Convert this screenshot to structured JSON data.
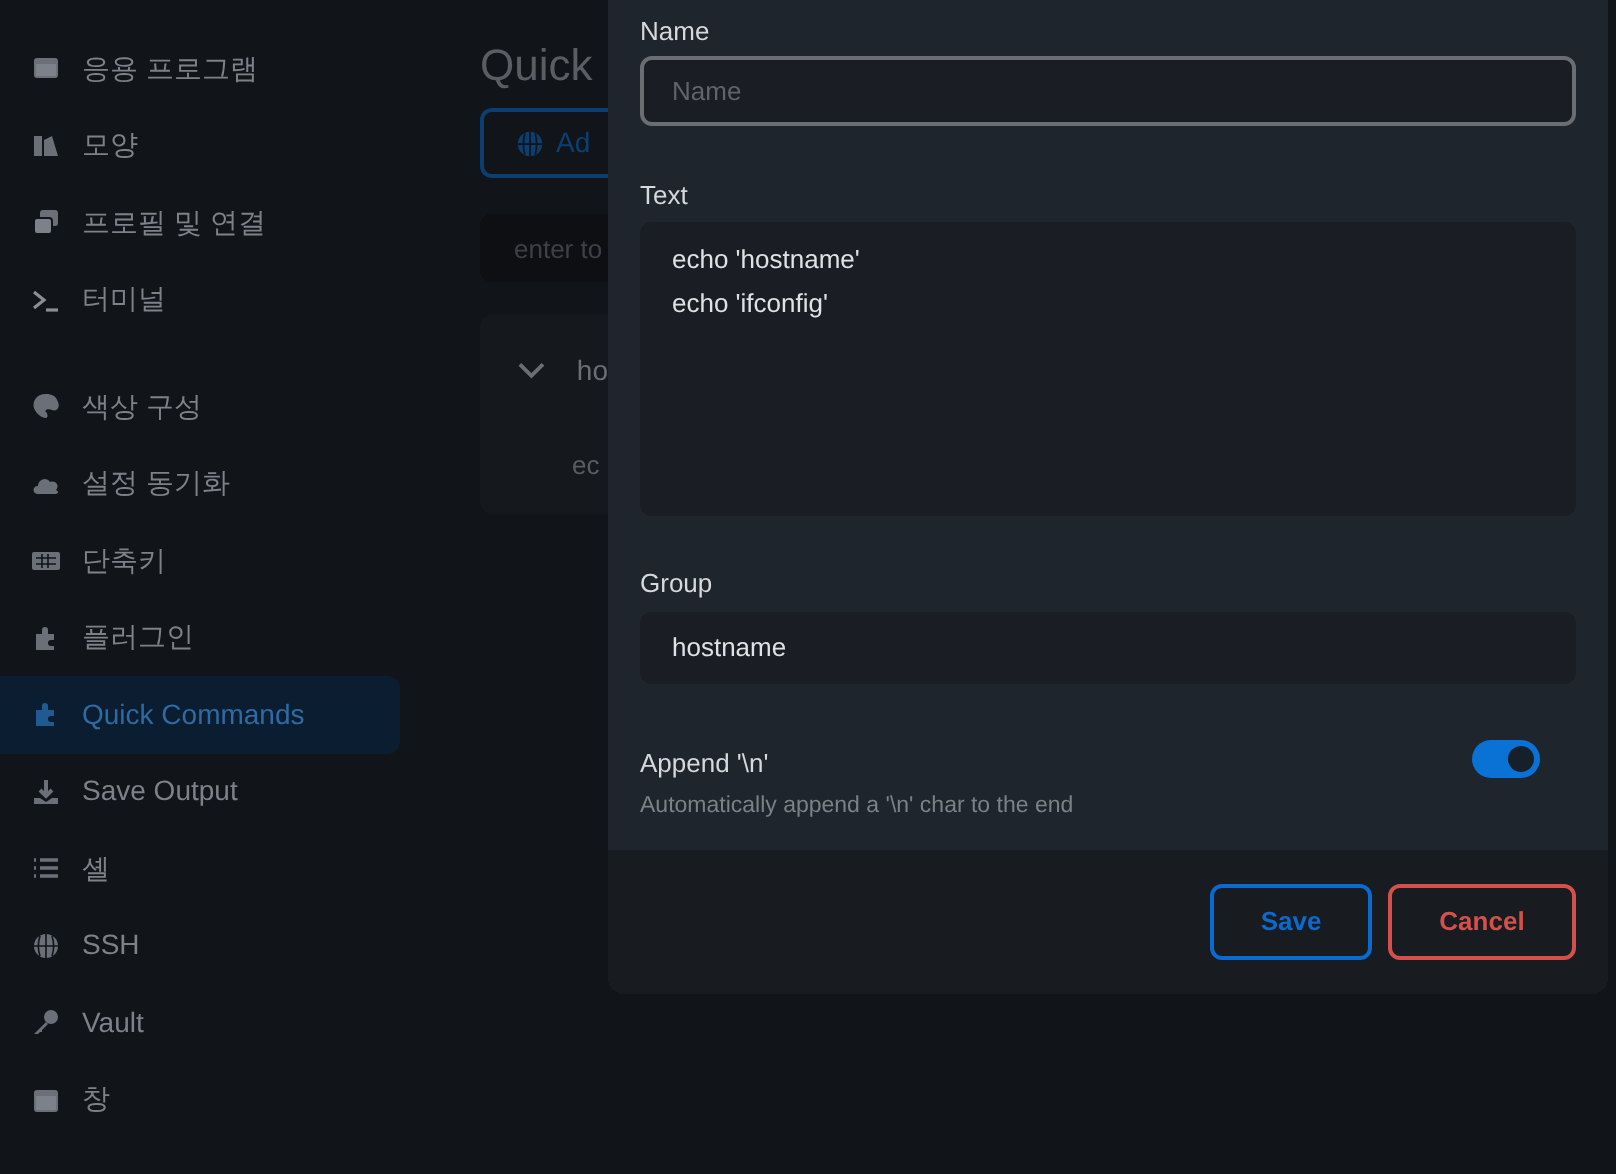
{
  "sidebar": {
    "sections": [
      {
        "items": [
          {
            "label": "응용 프로그램",
            "selected": false
          },
          {
            "label": "모양",
            "selected": false
          },
          {
            "label": "프로필 및 연결",
            "selected": false
          },
          {
            "label": "터미널",
            "selected": false
          }
        ]
      },
      {
        "items": [
          {
            "label": "색상 구성",
            "selected": false
          },
          {
            "label": "설정 동기화",
            "selected": false
          },
          {
            "label": "단축키",
            "selected": false
          },
          {
            "label": "플러그인",
            "selected": false
          },
          {
            "label": "Quick Commands",
            "selected": true
          },
          {
            "label": "Save Output",
            "selected": false
          },
          {
            "label": "셸",
            "selected": false
          },
          {
            "label": "SSH",
            "selected": false
          },
          {
            "label": "Vault",
            "selected": false
          },
          {
            "label": "창",
            "selected": false
          }
        ]
      }
    ]
  },
  "page": {
    "title": "Quick",
    "add_button": "Ad",
    "search": {
      "placeholder": "enter to"
    },
    "group": {
      "name": "ho",
      "expanded": true,
      "commands": [
        "ec"
      ]
    }
  },
  "dialog": {
    "name": {
      "label": "Name",
      "placeholder": "Name"
    },
    "text": {
      "label": "Text",
      "lines": [
        "echo 'hostname'",
        "echo 'ifconfig'"
      ]
    },
    "group": {
      "label": "Group",
      "value": "hostname"
    },
    "append": {
      "label": "Append '\\n'",
      "description": "Automatically append a '\\n' char to the end",
      "on": true
    },
    "buttons": [
      {
        "label": "Save",
        "kind": "save"
      },
      {
        "label": "Cancel",
        "kind": "cancel"
      }
    ]
  }
}
